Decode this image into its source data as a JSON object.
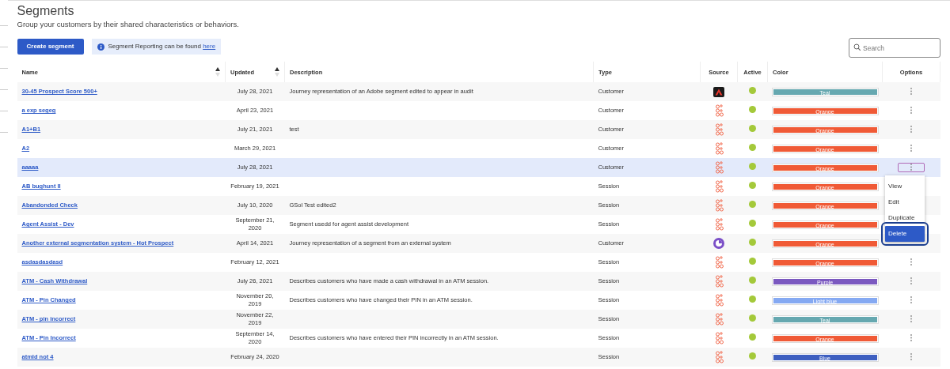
{
  "header": {
    "title": "Segments",
    "subtitle": "Group your customers by their shared characteristics or behaviors."
  },
  "create_button": "Create segment",
  "info_banner": {
    "text": "Segment Reporting can be found ",
    "link": "here"
  },
  "search": {
    "placeholder": "Search"
  },
  "table": {
    "columns": [
      {
        "label": "Name",
        "sortable": true
      },
      {
        "label": "Updated",
        "sortable": true
      },
      {
        "label": "Description",
        "sortable": false
      },
      {
        "label": "Type",
        "sortable": false
      },
      {
        "label": "Source",
        "sortable": false
      },
      {
        "label": "Active",
        "sortable": false
      },
      {
        "label": "Color",
        "sortable": false
      },
      {
        "label": "Options",
        "sortable": false
      }
    ],
    "rows": [
      {
        "name": "30-45 Prospect Score 500+",
        "updated": "July 28, 2021",
        "description": "Journey representation of an Adobe segment edited to appear in audit",
        "type": "Customer",
        "source": {
          "kind": "adobe"
        },
        "active": true,
        "color_label": "Teal",
        "color": "#66a8b0",
        "selected": false,
        "menu_open": false
      },
      {
        "name": "a exp segeg",
        "updated": "April 23, 2021",
        "description": "",
        "type": "Customer",
        "source": {
          "kind": "journey"
        },
        "active": true,
        "color_label": "Orange",
        "color": "#f05a36",
        "selected": false,
        "menu_open": false
      },
      {
        "name": "A1+B1",
        "updated": "July 21, 2021",
        "description": "test",
        "type": "Customer",
        "source": {
          "kind": "journey"
        },
        "active": true,
        "color_label": "Orange",
        "color": "#f05a36",
        "selected": false,
        "menu_open": false
      },
      {
        "name": "A2",
        "updated": "March 29, 2021",
        "description": "",
        "type": "Customer",
        "source": {
          "kind": "journey"
        },
        "active": true,
        "color_label": "Orange",
        "color": "#f05a36",
        "selected": false,
        "menu_open": false
      },
      {
        "name": "aaaaa",
        "updated": "July 28, 2021",
        "description": "",
        "type": "Customer",
        "source": {
          "kind": "journey"
        },
        "active": true,
        "color_label": "Orange",
        "color": "#f05a36",
        "selected": true,
        "menu_open": true
      },
      {
        "name": "AB bughunt II",
        "updated": "February 19, 2021",
        "description": "",
        "type": "Session",
        "source": {
          "kind": "journey"
        },
        "active": true,
        "color_label": "Orange",
        "color": "#f05a36",
        "selected": false,
        "menu_open": false
      },
      {
        "name": "Abandonded Check",
        "updated": "July 10, 2020",
        "description": "GSol Test edited2",
        "type": "Session",
        "source": {
          "kind": "journey"
        },
        "active": true,
        "color_label": "Orange",
        "color": "#f05a36",
        "selected": false,
        "menu_open": false
      },
      {
        "name": "Agent Assist - Dev",
        "updated": "September 21, 2020",
        "description": "Segment usedd for agent assist development",
        "type": "Session",
        "source": {
          "kind": "journey"
        },
        "active": true,
        "color_label": "Orange",
        "color": "#f05a36",
        "selected": false,
        "menu_open": false
      },
      {
        "name": "Another external segmentation system - Hot Prospect",
        "updated": "April 14, 2021",
        "description": "Journey representation of a segment from an external system",
        "type": "Customer",
        "source": {
          "kind": "external"
        },
        "active": true,
        "color_label": "Orange",
        "color": "#f05a36",
        "selected": false,
        "menu_open": false
      },
      {
        "name": "asdasdasdasd",
        "updated": "February 12, 2021",
        "description": "",
        "type": "Session",
        "source": {
          "kind": "journey"
        },
        "active": true,
        "color_label": "Orange",
        "color": "#f05a36",
        "selected": false,
        "menu_open": false
      },
      {
        "name": "ATM - Cash Withdrawal",
        "updated": "July 26, 2021",
        "description": "Describes customers who have made a cash withdrawal in an ATM session.",
        "type": "Session",
        "source": {
          "kind": "journey"
        },
        "active": true,
        "color_label": "Purple",
        "color": "#7b59c0",
        "selected": false,
        "menu_open": false
      },
      {
        "name": "ATM - Pin Changed",
        "updated": "November 20, 2019",
        "description": "Describes customers who have changed their PIN in an ATM session.",
        "type": "Session",
        "source": {
          "kind": "journey"
        },
        "active": true,
        "color_label": "Light blue",
        "color": "#85a9f2",
        "selected": false,
        "menu_open": false
      },
      {
        "name": "ATM - pin incorrect",
        "updated": "November 22, 2019",
        "description": "",
        "type": "Session",
        "source": {
          "kind": "journey"
        },
        "active": true,
        "color_label": "Teal",
        "color": "#66a8b0",
        "selected": false,
        "menu_open": false
      },
      {
        "name": "ATM - Pin Incorrect",
        "updated": "September 14, 2020",
        "description": "Describes customers who have entered their PIN incorrectly in an ATM session.",
        "type": "Session",
        "source": {
          "kind": "journey"
        },
        "active": true,
        "color_label": "Orange",
        "color": "#f05a36",
        "selected": false,
        "menu_open": false
      },
      {
        "name": "atmId not 4",
        "updated": "February 24, 2020",
        "description": "",
        "type": "Session",
        "source": {
          "kind": "journey"
        },
        "active": true,
        "color_label": "Blue",
        "color": "#3e5fc0",
        "selected": false,
        "menu_open": false
      }
    ]
  },
  "options_menu": {
    "items": [
      {
        "label": "View",
        "selected": false
      },
      {
        "label": "Edit",
        "selected": false
      },
      {
        "label": "Duplicate",
        "selected": false
      },
      {
        "label": "Delete",
        "selected": true
      }
    ]
  }
}
